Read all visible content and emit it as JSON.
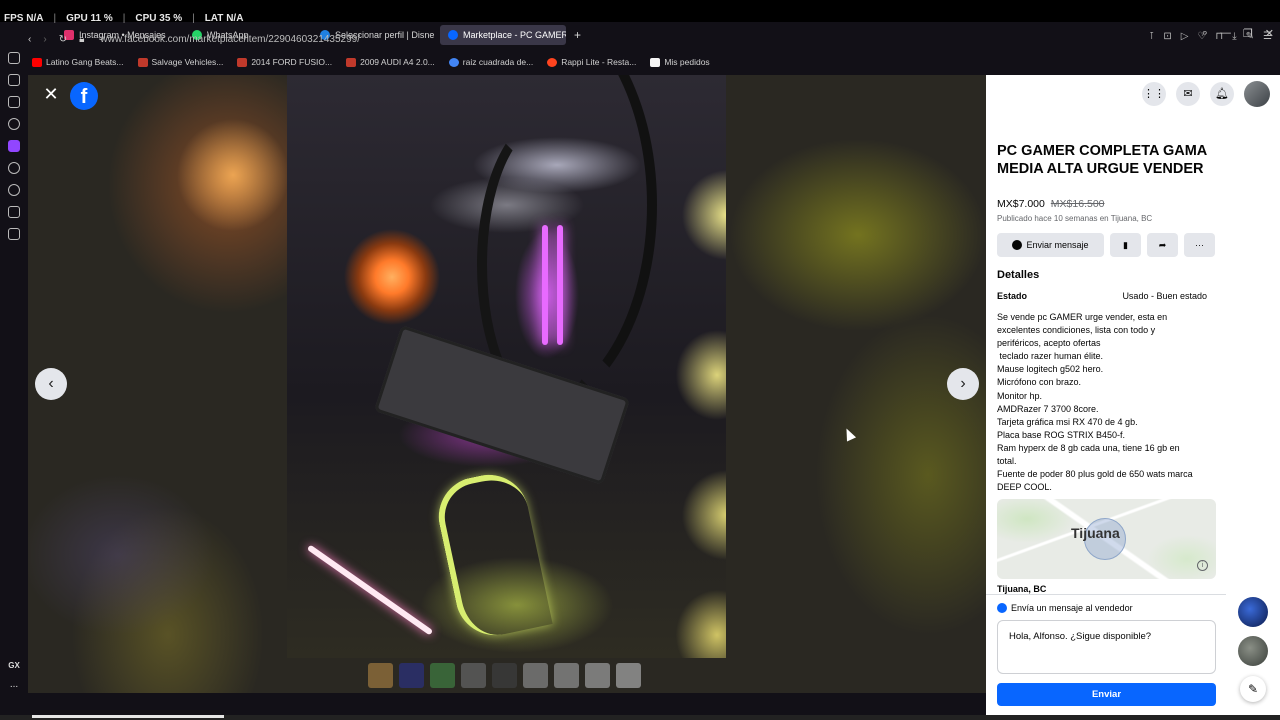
{
  "hud": {
    "fps_label": "FPS",
    "fps": "N/A",
    "gpu_label": "GPU",
    "gpu": "11 %",
    "cpu_label": "CPU",
    "cpu": "35 %",
    "lat_label": "LAT",
    "lat": "N/A"
  },
  "tabs": [
    {
      "label": "Instagram • Mensajes",
      "color": "#e1306c"
    },
    {
      "label": "WhatsApp",
      "color": "#25d366"
    },
    {
      "label": "Seleccionar perfil | Disne",
      "color": "#1f80e0"
    },
    {
      "label": "Marketplace - PC GAMER",
      "color": "#0866ff"
    }
  ],
  "address": {
    "url": "www.facebook.com/marketplace/item/2290460321435299/"
  },
  "bookmarks": [
    {
      "label": "Latino Gang Beats...",
      "color": "#ff0000"
    },
    {
      "label": "Salvage Vehicles...",
      "color": "#c0392b"
    },
    {
      "label": "2014 FORD FUSIO...",
      "color": "#c0392b"
    },
    {
      "label": "2009 AUDI A4 2.0...",
      "color": "#c0392b"
    },
    {
      "label": "raiz cuadrada de...",
      "color": "#4285f4"
    },
    {
      "label": "Rappi Lite - Resta...",
      "color": "#ff441f"
    },
    {
      "label": "Mis pedidos",
      "color": "#f5f5f5"
    }
  ],
  "dock": {
    "gx_label": "GX",
    "more_label": "..."
  },
  "viewer": {
    "close_icon": "close-icon",
    "fb_logo_letter": "f",
    "prev_label": "‹",
    "next_label": "›",
    "thumb_colors": [
      "#8a6a3a",
      "#2a2f6e",
      "#3c6e3c",
      "#5a5a5a",
      "#3a3a3a",
      "#777777",
      "#808080",
      "#8a8a8a",
      "#929292"
    ]
  },
  "listing": {
    "title": "PC GAMER COMPLETA GAMA MEDIA ALTA URGUE VENDER",
    "price": "MX$7.000",
    "old_price": "MX$16.500",
    "posted": "Publicado hace 10 semanas en Tijuana, BC",
    "send_message_label": "Enviar mensaje",
    "details_heading": "Detalles",
    "condition_key": "Estado",
    "condition_value": "Usado - Buen estado",
    "description_lines": [
      "Se vende pc GAMER urge vender, esta en",
      "excelentes condiciones, lista con todo y",
      "periféricos, acepto ofertas",
      " teclado razer human élite.",
      "Mause logitech g502 hero.",
      "Micrófono con brazo.",
      "Monitor hp.",
      "AMDRazer 7 3700 8core.",
      "Tarjeta gráfica msi RX 470 de 4 gb.",
      "Placa base ROG STRIX B450-f.",
      "Ram hyperx de 8 gb cada una, tiene 16 gb en",
      "total.",
      "Fuente de poder 80 plus gold de 650 wats marca",
      "DEEP COOL."
    ],
    "map_label": "Tijuana",
    "location": "Tijuana, BC",
    "message_heading": "Envía un mensaje al vendedor",
    "message_value": "Hola, Alfonso. ¿Sigue disponible?",
    "send_label": "Enviar"
  }
}
